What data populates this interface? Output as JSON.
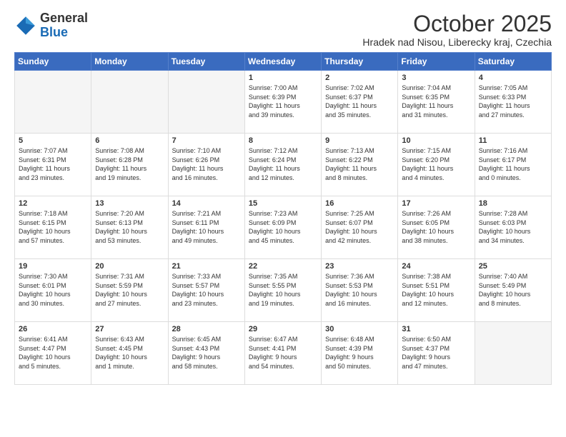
{
  "header": {
    "logo_general": "General",
    "logo_blue": "Blue",
    "month_title": "October 2025",
    "subtitle": "Hradek nad Nisou, Liberecky kraj, Czechia"
  },
  "days_of_week": [
    "Sunday",
    "Monday",
    "Tuesday",
    "Wednesday",
    "Thursday",
    "Friday",
    "Saturday"
  ],
  "weeks": [
    [
      {
        "day": "",
        "info": ""
      },
      {
        "day": "",
        "info": ""
      },
      {
        "day": "",
        "info": ""
      },
      {
        "day": "1",
        "info": "Sunrise: 7:00 AM\nSunset: 6:39 PM\nDaylight: 11 hours\nand 39 minutes."
      },
      {
        "day": "2",
        "info": "Sunrise: 7:02 AM\nSunset: 6:37 PM\nDaylight: 11 hours\nand 35 minutes."
      },
      {
        "day": "3",
        "info": "Sunrise: 7:04 AM\nSunset: 6:35 PM\nDaylight: 11 hours\nand 31 minutes."
      },
      {
        "day": "4",
        "info": "Sunrise: 7:05 AM\nSunset: 6:33 PM\nDaylight: 11 hours\nand 27 minutes."
      }
    ],
    [
      {
        "day": "5",
        "info": "Sunrise: 7:07 AM\nSunset: 6:31 PM\nDaylight: 11 hours\nand 23 minutes."
      },
      {
        "day": "6",
        "info": "Sunrise: 7:08 AM\nSunset: 6:28 PM\nDaylight: 11 hours\nand 19 minutes."
      },
      {
        "day": "7",
        "info": "Sunrise: 7:10 AM\nSunset: 6:26 PM\nDaylight: 11 hours\nand 16 minutes."
      },
      {
        "day": "8",
        "info": "Sunrise: 7:12 AM\nSunset: 6:24 PM\nDaylight: 11 hours\nand 12 minutes."
      },
      {
        "day": "9",
        "info": "Sunrise: 7:13 AM\nSunset: 6:22 PM\nDaylight: 11 hours\nand 8 minutes."
      },
      {
        "day": "10",
        "info": "Sunrise: 7:15 AM\nSunset: 6:20 PM\nDaylight: 11 hours\nand 4 minutes."
      },
      {
        "day": "11",
        "info": "Sunrise: 7:16 AM\nSunset: 6:17 PM\nDaylight: 11 hours\nand 0 minutes."
      }
    ],
    [
      {
        "day": "12",
        "info": "Sunrise: 7:18 AM\nSunset: 6:15 PM\nDaylight: 10 hours\nand 57 minutes."
      },
      {
        "day": "13",
        "info": "Sunrise: 7:20 AM\nSunset: 6:13 PM\nDaylight: 10 hours\nand 53 minutes."
      },
      {
        "day": "14",
        "info": "Sunrise: 7:21 AM\nSunset: 6:11 PM\nDaylight: 10 hours\nand 49 minutes."
      },
      {
        "day": "15",
        "info": "Sunrise: 7:23 AM\nSunset: 6:09 PM\nDaylight: 10 hours\nand 45 minutes."
      },
      {
        "day": "16",
        "info": "Sunrise: 7:25 AM\nSunset: 6:07 PM\nDaylight: 10 hours\nand 42 minutes."
      },
      {
        "day": "17",
        "info": "Sunrise: 7:26 AM\nSunset: 6:05 PM\nDaylight: 10 hours\nand 38 minutes."
      },
      {
        "day": "18",
        "info": "Sunrise: 7:28 AM\nSunset: 6:03 PM\nDaylight: 10 hours\nand 34 minutes."
      }
    ],
    [
      {
        "day": "19",
        "info": "Sunrise: 7:30 AM\nSunset: 6:01 PM\nDaylight: 10 hours\nand 30 minutes."
      },
      {
        "day": "20",
        "info": "Sunrise: 7:31 AM\nSunset: 5:59 PM\nDaylight: 10 hours\nand 27 minutes."
      },
      {
        "day": "21",
        "info": "Sunrise: 7:33 AM\nSunset: 5:57 PM\nDaylight: 10 hours\nand 23 minutes."
      },
      {
        "day": "22",
        "info": "Sunrise: 7:35 AM\nSunset: 5:55 PM\nDaylight: 10 hours\nand 19 minutes."
      },
      {
        "day": "23",
        "info": "Sunrise: 7:36 AM\nSunset: 5:53 PM\nDaylight: 10 hours\nand 16 minutes."
      },
      {
        "day": "24",
        "info": "Sunrise: 7:38 AM\nSunset: 5:51 PM\nDaylight: 10 hours\nand 12 minutes."
      },
      {
        "day": "25",
        "info": "Sunrise: 7:40 AM\nSunset: 5:49 PM\nDaylight: 10 hours\nand 8 minutes."
      }
    ],
    [
      {
        "day": "26",
        "info": "Sunrise: 6:41 AM\nSunset: 4:47 PM\nDaylight: 10 hours\nand 5 minutes."
      },
      {
        "day": "27",
        "info": "Sunrise: 6:43 AM\nSunset: 4:45 PM\nDaylight: 10 hours\nand 1 minute."
      },
      {
        "day": "28",
        "info": "Sunrise: 6:45 AM\nSunset: 4:43 PM\nDaylight: 9 hours\nand 58 minutes."
      },
      {
        "day": "29",
        "info": "Sunrise: 6:47 AM\nSunset: 4:41 PM\nDaylight: 9 hours\nand 54 minutes."
      },
      {
        "day": "30",
        "info": "Sunrise: 6:48 AM\nSunset: 4:39 PM\nDaylight: 9 hours\nand 50 minutes."
      },
      {
        "day": "31",
        "info": "Sunrise: 6:50 AM\nSunset: 4:37 PM\nDaylight: 9 hours\nand 47 minutes."
      },
      {
        "day": "",
        "info": ""
      }
    ]
  ]
}
